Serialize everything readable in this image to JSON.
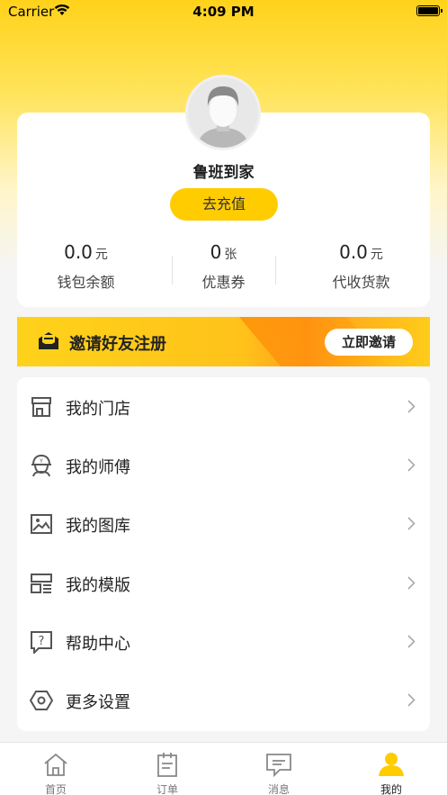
{
  "status_bar": {
    "carrier": "Carrier",
    "time": "4:09 PM"
  },
  "profile": {
    "username": "鲁班到家",
    "recharge_label": "去充值",
    "stats": [
      {
        "value": "0.0",
        "unit": "元",
        "label": "钱包余额"
      },
      {
        "value": "0",
        "unit": "张",
        "label": "优惠券"
      },
      {
        "value": "0.0",
        "unit": "元",
        "label": "代收货款"
      }
    ]
  },
  "invite": {
    "text": "邀请好友注册",
    "button": "立即邀请"
  },
  "menu": [
    {
      "label": "我的门店",
      "icon": "store-icon"
    },
    {
      "label": "我的师傅",
      "icon": "worker-icon"
    },
    {
      "label": "我的图库",
      "icon": "image-icon"
    },
    {
      "label": "我的模版",
      "icon": "template-icon"
    },
    {
      "label": "帮助中心",
      "icon": "help-icon"
    },
    {
      "label": "更多设置",
      "icon": "settings-icon"
    }
  ],
  "tabs": [
    {
      "label": "首页",
      "icon": "home-icon",
      "active": false
    },
    {
      "label": "订单",
      "icon": "order-icon",
      "active": false
    },
    {
      "label": "消息",
      "icon": "message-icon",
      "active": false
    },
    {
      "label": "我的",
      "icon": "profile-icon",
      "active": true
    }
  ],
  "colors": {
    "accent": "#ffcc00",
    "background": "#f5f5f5",
    "text": "#222222",
    "icon": "#555555"
  }
}
